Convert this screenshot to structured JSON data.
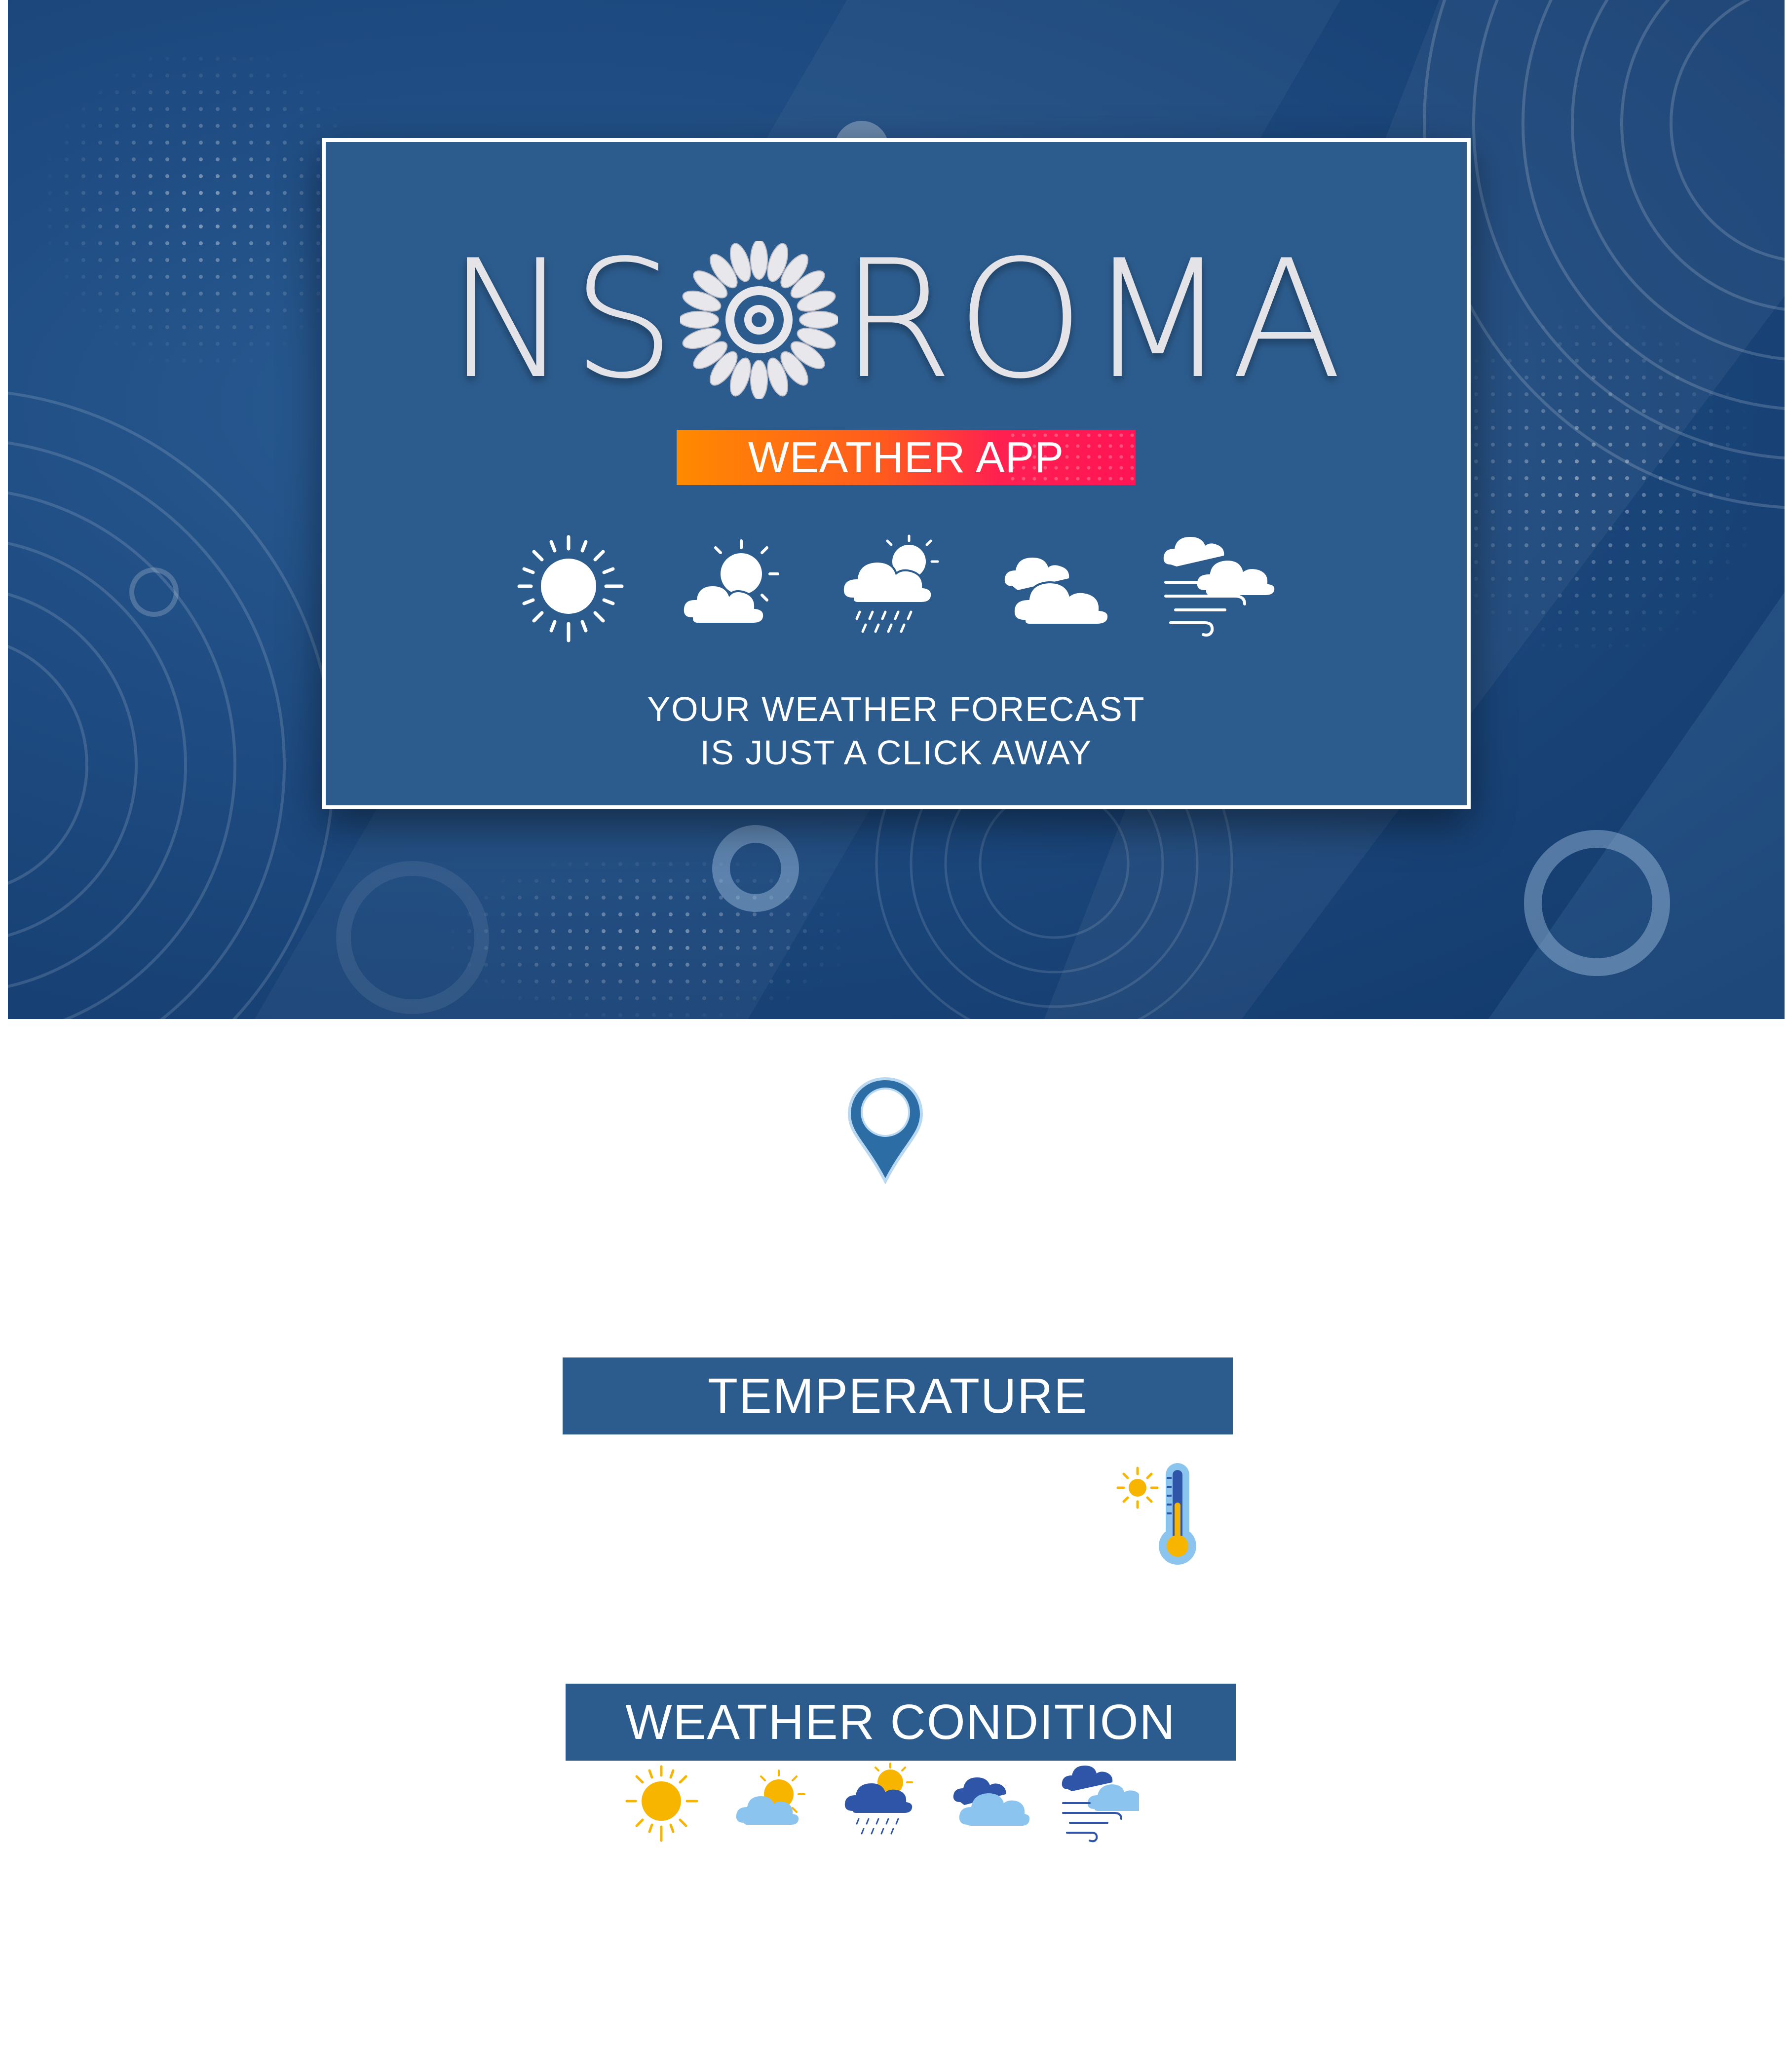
{
  "hero": {
    "logo_left": "NS",
    "logo_right": "ROMA",
    "badge": "WEATHER APP",
    "tagline_line1": "YOUR WEATHER FORECAST",
    "tagline_line2": "IS JUST A CLICK AWAY",
    "icons": [
      "sun-icon",
      "partly-cloudy-icon",
      "rain-icon",
      "cloudy-icon",
      "wind-icon"
    ]
  },
  "location": {
    "icon": "location-pin-icon"
  },
  "temperature": {
    "header": "TEMPERATURE",
    "icon": "thermometer-sun-icon"
  },
  "condition": {
    "header": "WEATHER CONDITION",
    "icons": [
      "sun-icon",
      "partly-cloudy-icon",
      "rain-icon",
      "cloudy-icon",
      "wind-icon"
    ]
  },
  "colors": {
    "brand_blue": "#2c5c8e",
    "badge_orange": "#ff8a00",
    "badge_pink": "#ff1455",
    "sun_yellow": "#f7b500",
    "cloud_light": "#8cc4f0",
    "cloud_dark": "#2f55a8"
  }
}
